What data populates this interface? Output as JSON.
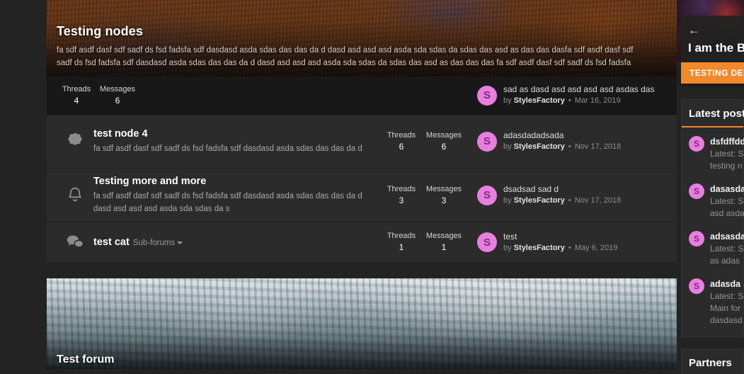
{
  "category": {
    "title": "Testing nodes",
    "description_lines": [
      "fa sdf asdf dasf sdf sadf ds fsd fadsfa sdf dasdasd asda sdas das das da d dasd asd asd asd asda sda sdas da sdas das asd as das das dasfa sdf asdf dasf sdf",
      "sadf ds fsd fadsfa sdf dasdasd asda sdas das das da d dasd asd asd asd asda sda sdas da sdas das asd as das das das fa sdf asdf dasf sdf sadf ds fsd fadsfa"
    ],
    "stats": [
      {
        "label": "Threads",
        "value": "4"
      },
      {
        "label": "Messages",
        "value": "6"
      }
    ],
    "latest_post": {
      "avatar_letter": "S",
      "title": "sad as dasd asd asd asd asd asdas das",
      "by_label": "by",
      "author": "StylesFactory",
      "separator": "•",
      "date": "Mar 16, 2019"
    }
  },
  "nodes": [
    {
      "icon": "blob-icon",
      "title": "test node 4",
      "subforums_label": "",
      "description": "fa sdf asdf dasf sdf sadf ds fsd fadsfa sdf dasdasd asda sdas das das da d",
      "stats": [
        {
          "label": "Threads",
          "value": "6"
        },
        {
          "label": "Messages",
          "value": "6"
        }
      ],
      "latest_post": {
        "avatar_letter": "S",
        "title": "adasdadadsada",
        "by_label": "by",
        "author": "StylesFactory",
        "separator": "•",
        "date": "Nov 17, 2018"
      }
    },
    {
      "icon": "bell-icon",
      "title": "Testing more and more",
      "subforums_label": "",
      "description": "fa sdf asdf dasf sdf sadf ds fsd fadsfa sdf dasdasd asda sdas das das da d dasd asd asd asd asda sda sdas da s",
      "stats": [
        {
          "label": "Threads",
          "value": "3"
        },
        {
          "label": "Messages",
          "value": "3"
        }
      ],
      "latest_post": {
        "avatar_letter": "S",
        "title": "dsadsad sad d",
        "by_label": "by",
        "author": "StylesFactory",
        "separator": "•",
        "date": "Nov 17, 2018"
      }
    },
    {
      "icon": "speech-bubbles-icon",
      "title": "test cat",
      "subforums_label": "Sub-forums",
      "description": "",
      "stats": [
        {
          "label": "Threads",
          "value": "1"
        },
        {
          "label": "Messages",
          "value": "1"
        }
      ],
      "latest_post": {
        "avatar_letter": "S",
        "title": "test",
        "by_label": "by",
        "author": "StylesFactory",
        "separator": "•",
        "date": "May 6, 2019"
      }
    }
  ],
  "forum_block": {
    "title": "Test forum"
  },
  "sidebar": {
    "hero": {
      "back_glyph": "←",
      "title": "I am the B",
      "button_label": "TESTING DESC"
    },
    "latest_posts": {
      "heading": "Latest post",
      "items": [
        {
          "avatar_letter": "S",
          "title": "dsfdffdd",
          "line1": "Latest: S",
          "line2": "testing n"
        },
        {
          "avatar_letter": "S",
          "title": "dasasda",
          "line1": "Latest: S",
          "line2": "asd asda"
        },
        {
          "avatar_letter": "S",
          "title": "adsasda",
          "line1": "Latest: S",
          "line2": "as adas"
        },
        {
          "avatar_letter": "S",
          "title": "adasda",
          "line1": "Latest: S",
          "line2": "Main for",
          "line3": "dasdasd"
        }
      ]
    },
    "partners": {
      "heading": "Partners"
    }
  },
  "colors": {
    "accent_orange": "#f08a2c",
    "avatar_pink": "#e87fe0",
    "page_bg": "#232323",
    "row_bg": "#2b2b2b"
  }
}
